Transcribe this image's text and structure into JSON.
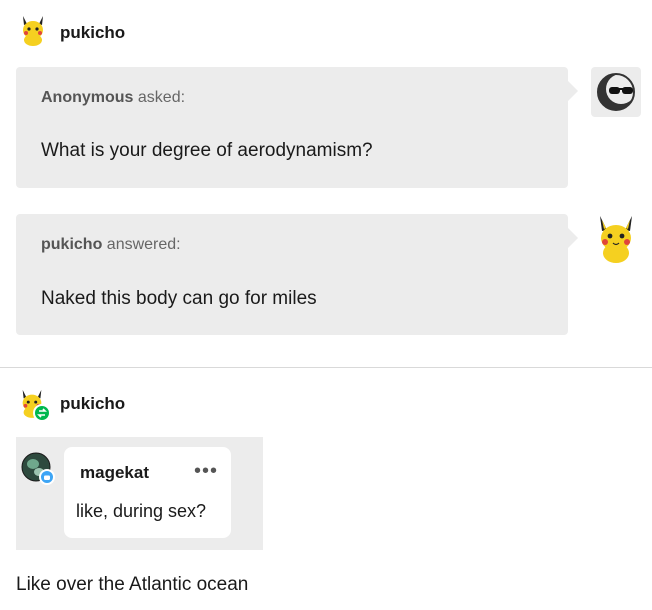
{
  "post1": {
    "username": "pukicho",
    "question": {
      "asker": "Anonymous",
      "verb": "asked:",
      "text": "What is your degree of aerodynamism?",
      "avatar_icon": "sunglasses-anon-avatar"
    },
    "answer": {
      "answerer": "pukicho",
      "verb": "answered:",
      "text": "Naked this body can go for miles",
      "avatar_icon": "pikachu-avatar"
    }
  },
  "post2": {
    "username": "pukicho",
    "reblog_badge_color": "#00b84f",
    "comment": {
      "username": "magekat",
      "more_label": "•••",
      "text": "like, during sex?",
      "badge_color": "#3da5f5"
    },
    "caption": "Like over the Atlantic ocean"
  }
}
